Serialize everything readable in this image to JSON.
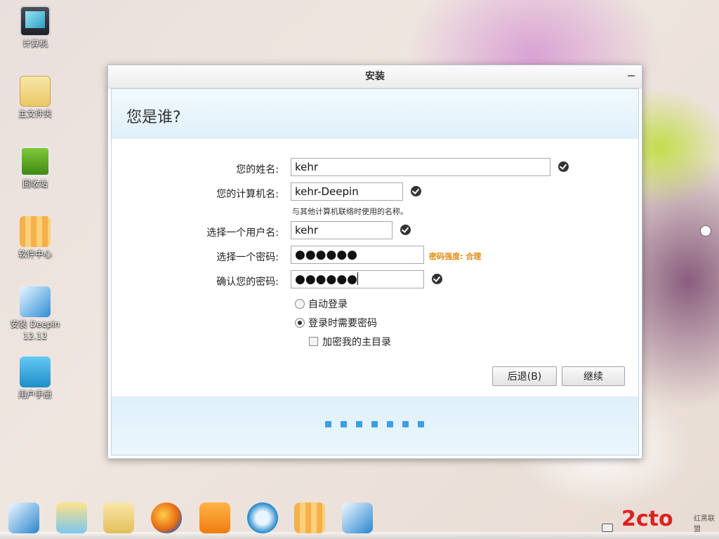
{
  "desktop": {
    "icons": [
      {
        "label": "计算机"
      },
      {
        "label": "主文件夹"
      },
      {
        "label": "回收站"
      },
      {
        "label": "软件中心"
      },
      {
        "label": "安装 Deepin 12.12"
      },
      {
        "label": "用户手册"
      }
    ]
  },
  "window": {
    "title": "安装",
    "heading": "您是谁?",
    "form": {
      "name_label": "您的姓名:",
      "name_value": "kehr",
      "computer_label": "您的计算机名:",
      "computer_value": "kehr-Deepin",
      "computer_hint": "与其他计算机联络时使用的名称。",
      "username_label": "选择一个用户名:",
      "username_value": "kehr",
      "password_label": "选择一个密码:",
      "password_value": "●●●●●●",
      "password_strength": "密码强度: 合理",
      "confirm_label": "确认您的密码:",
      "confirm_value": "●●●●●●"
    },
    "options": {
      "auto_login": "自动登录",
      "require_password": "登录时需要密码",
      "encrypt_home": "加密我的主目录"
    },
    "buttons": {
      "back": "后退(B)",
      "continue": "继续"
    },
    "progress": {
      "total_steps": 7
    }
  },
  "watermark": {
    "text": "2cto",
    "small": "红黑联盟"
  }
}
